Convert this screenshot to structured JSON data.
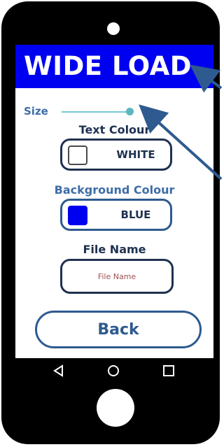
{
  "banner": {
    "text": "WIDE LOAD",
    "background": "#0000f0",
    "text_color": "#ffffff"
  },
  "size": {
    "label": "Size",
    "value_percent": 100
  },
  "text_colour": {
    "label": "Text Colour",
    "value": "WHITE",
    "swatch": "#ffffff"
  },
  "background_colour": {
    "label": "Background Colour",
    "value": "BLUE",
    "swatch": "#0000f0"
  },
  "file_name": {
    "label": "File Name",
    "placeholder": "File Name"
  },
  "back_button": {
    "label": "Back"
  },
  "navbar": {
    "back_icon": "triangle-back-icon",
    "home_icon": "circle-home-icon",
    "recents_icon": "square-recents-icon"
  }
}
